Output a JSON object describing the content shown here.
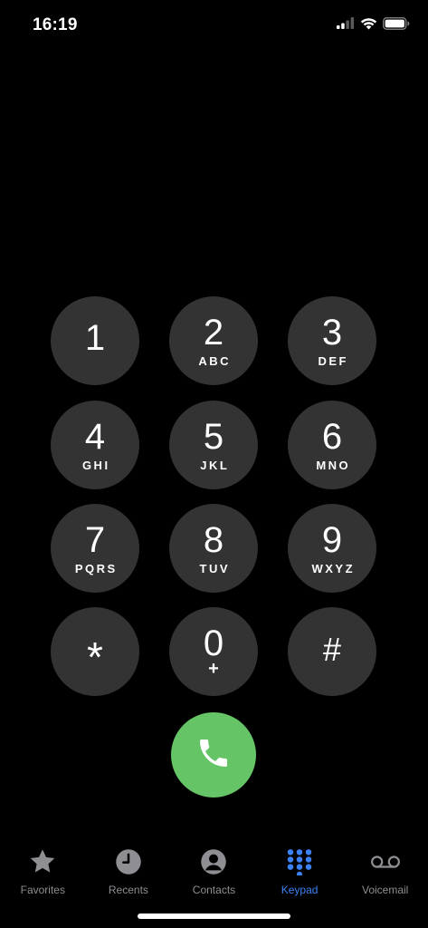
{
  "status_bar": {
    "time": "16:19"
  },
  "keypad": {
    "keys": [
      {
        "digit": "1",
        "letters": ""
      },
      {
        "digit": "2",
        "letters": "ABC"
      },
      {
        "digit": "3",
        "letters": "DEF"
      },
      {
        "digit": "4",
        "letters": "GHI"
      },
      {
        "digit": "5",
        "letters": "JKL"
      },
      {
        "digit": "6",
        "letters": "MNO"
      },
      {
        "digit": "7",
        "letters": "PQRS"
      },
      {
        "digit": "8",
        "letters": "TUV"
      },
      {
        "digit": "9",
        "letters": "WXYZ"
      },
      {
        "digit": "*",
        "letters": ""
      },
      {
        "digit": "0",
        "letters": "+"
      },
      {
        "digit": "#",
        "letters": ""
      }
    ]
  },
  "call_button": {
    "icon": "phone-icon"
  },
  "tab_bar": {
    "tabs": [
      {
        "label": "Favorites",
        "icon": "star-icon",
        "active": false
      },
      {
        "label": "Recents",
        "icon": "clock-icon",
        "active": false
      },
      {
        "label": "Contacts",
        "icon": "person-icon",
        "active": false
      },
      {
        "label": "Keypad",
        "icon": "keypad-grid-icon",
        "active": true
      },
      {
        "label": "Voicemail",
        "icon": "voicemail-icon",
        "active": false
      }
    ]
  },
  "colors": {
    "background": "#000000",
    "key": "#333333",
    "call_green": "#65C466",
    "tab_active": "#3B82F6",
    "tab_inactive": "#8E8E93"
  }
}
